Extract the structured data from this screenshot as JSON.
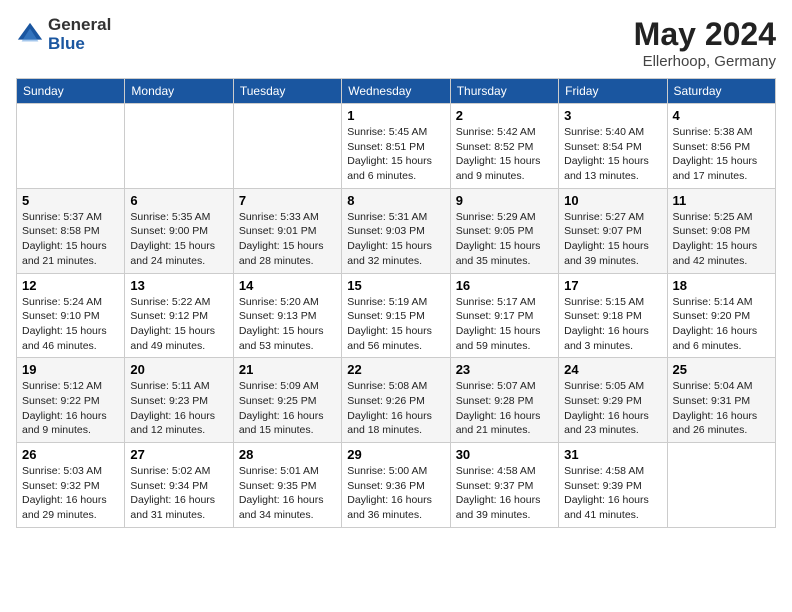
{
  "logo": {
    "general": "General",
    "blue": "Blue"
  },
  "title": "May 2024",
  "location": "Ellerhoop, Germany",
  "weekdays": [
    "Sunday",
    "Monday",
    "Tuesday",
    "Wednesday",
    "Thursday",
    "Friday",
    "Saturday"
  ],
  "weeks": [
    [
      {
        "day": "",
        "info": ""
      },
      {
        "day": "",
        "info": ""
      },
      {
        "day": "",
        "info": ""
      },
      {
        "day": "1",
        "info": "Sunrise: 5:45 AM\nSunset: 8:51 PM\nDaylight: 15 hours\nand 6 minutes."
      },
      {
        "day": "2",
        "info": "Sunrise: 5:42 AM\nSunset: 8:52 PM\nDaylight: 15 hours\nand 9 minutes."
      },
      {
        "day": "3",
        "info": "Sunrise: 5:40 AM\nSunset: 8:54 PM\nDaylight: 15 hours\nand 13 minutes."
      },
      {
        "day": "4",
        "info": "Sunrise: 5:38 AM\nSunset: 8:56 PM\nDaylight: 15 hours\nand 17 minutes."
      }
    ],
    [
      {
        "day": "5",
        "info": "Sunrise: 5:37 AM\nSunset: 8:58 PM\nDaylight: 15 hours\nand 21 minutes."
      },
      {
        "day": "6",
        "info": "Sunrise: 5:35 AM\nSunset: 9:00 PM\nDaylight: 15 hours\nand 24 minutes."
      },
      {
        "day": "7",
        "info": "Sunrise: 5:33 AM\nSunset: 9:01 PM\nDaylight: 15 hours\nand 28 minutes."
      },
      {
        "day": "8",
        "info": "Sunrise: 5:31 AM\nSunset: 9:03 PM\nDaylight: 15 hours\nand 32 minutes."
      },
      {
        "day": "9",
        "info": "Sunrise: 5:29 AM\nSunset: 9:05 PM\nDaylight: 15 hours\nand 35 minutes."
      },
      {
        "day": "10",
        "info": "Sunrise: 5:27 AM\nSunset: 9:07 PM\nDaylight: 15 hours\nand 39 minutes."
      },
      {
        "day": "11",
        "info": "Sunrise: 5:25 AM\nSunset: 9:08 PM\nDaylight: 15 hours\nand 42 minutes."
      }
    ],
    [
      {
        "day": "12",
        "info": "Sunrise: 5:24 AM\nSunset: 9:10 PM\nDaylight: 15 hours\nand 46 minutes."
      },
      {
        "day": "13",
        "info": "Sunrise: 5:22 AM\nSunset: 9:12 PM\nDaylight: 15 hours\nand 49 minutes."
      },
      {
        "day": "14",
        "info": "Sunrise: 5:20 AM\nSunset: 9:13 PM\nDaylight: 15 hours\nand 53 minutes."
      },
      {
        "day": "15",
        "info": "Sunrise: 5:19 AM\nSunset: 9:15 PM\nDaylight: 15 hours\nand 56 minutes."
      },
      {
        "day": "16",
        "info": "Sunrise: 5:17 AM\nSunset: 9:17 PM\nDaylight: 15 hours\nand 59 minutes."
      },
      {
        "day": "17",
        "info": "Sunrise: 5:15 AM\nSunset: 9:18 PM\nDaylight: 16 hours\nand 3 minutes."
      },
      {
        "day": "18",
        "info": "Sunrise: 5:14 AM\nSunset: 9:20 PM\nDaylight: 16 hours\nand 6 minutes."
      }
    ],
    [
      {
        "day": "19",
        "info": "Sunrise: 5:12 AM\nSunset: 9:22 PM\nDaylight: 16 hours\nand 9 minutes."
      },
      {
        "day": "20",
        "info": "Sunrise: 5:11 AM\nSunset: 9:23 PM\nDaylight: 16 hours\nand 12 minutes."
      },
      {
        "day": "21",
        "info": "Sunrise: 5:09 AM\nSunset: 9:25 PM\nDaylight: 16 hours\nand 15 minutes."
      },
      {
        "day": "22",
        "info": "Sunrise: 5:08 AM\nSunset: 9:26 PM\nDaylight: 16 hours\nand 18 minutes."
      },
      {
        "day": "23",
        "info": "Sunrise: 5:07 AM\nSunset: 9:28 PM\nDaylight: 16 hours\nand 21 minutes."
      },
      {
        "day": "24",
        "info": "Sunrise: 5:05 AM\nSunset: 9:29 PM\nDaylight: 16 hours\nand 23 minutes."
      },
      {
        "day": "25",
        "info": "Sunrise: 5:04 AM\nSunset: 9:31 PM\nDaylight: 16 hours\nand 26 minutes."
      }
    ],
    [
      {
        "day": "26",
        "info": "Sunrise: 5:03 AM\nSunset: 9:32 PM\nDaylight: 16 hours\nand 29 minutes."
      },
      {
        "day": "27",
        "info": "Sunrise: 5:02 AM\nSunset: 9:34 PM\nDaylight: 16 hours\nand 31 minutes."
      },
      {
        "day": "28",
        "info": "Sunrise: 5:01 AM\nSunset: 9:35 PM\nDaylight: 16 hours\nand 34 minutes."
      },
      {
        "day": "29",
        "info": "Sunrise: 5:00 AM\nSunset: 9:36 PM\nDaylight: 16 hours\nand 36 minutes."
      },
      {
        "day": "30",
        "info": "Sunrise: 4:58 AM\nSunset: 9:37 PM\nDaylight: 16 hours\nand 39 minutes."
      },
      {
        "day": "31",
        "info": "Sunrise: 4:58 AM\nSunset: 9:39 PM\nDaylight: 16 hours\nand 41 minutes."
      },
      {
        "day": "",
        "info": ""
      }
    ]
  ]
}
